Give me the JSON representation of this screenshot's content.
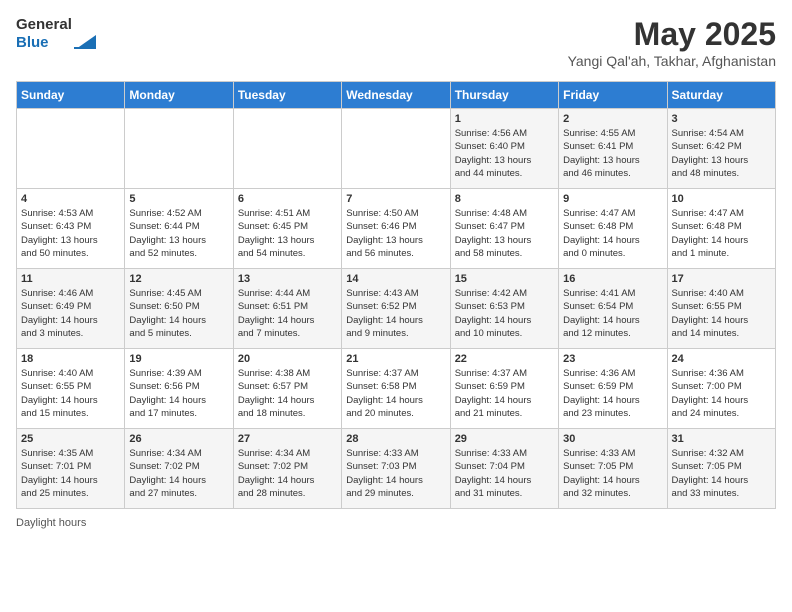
{
  "header": {
    "logo_general": "General",
    "logo_blue": "Blue",
    "month": "May 2025",
    "location": "Yangi Qal'ah, Takhar, Afghanistan"
  },
  "weekdays": [
    "Sunday",
    "Monday",
    "Tuesday",
    "Wednesday",
    "Thursday",
    "Friday",
    "Saturday"
  ],
  "weeks": [
    [
      {
        "day": "",
        "info": ""
      },
      {
        "day": "",
        "info": ""
      },
      {
        "day": "",
        "info": ""
      },
      {
        "day": "",
        "info": ""
      },
      {
        "day": "1",
        "info": "Sunrise: 4:56 AM\nSunset: 6:40 PM\nDaylight: 13 hours\nand 44 minutes."
      },
      {
        "day": "2",
        "info": "Sunrise: 4:55 AM\nSunset: 6:41 PM\nDaylight: 13 hours\nand 46 minutes."
      },
      {
        "day": "3",
        "info": "Sunrise: 4:54 AM\nSunset: 6:42 PM\nDaylight: 13 hours\nand 48 minutes."
      }
    ],
    [
      {
        "day": "4",
        "info": "Sunrise: 4:53 AM\nSunset: 6:43 PM\nDaylight: 13 hours\nand 50 minutes."
      },
      {
        "day": "5",
        "info": "Sunrise: 4:52 AM\nSunset: 6:44 PM\nDaylight: 13 hours\nand 52 minutes."
      },
      {
        "day": "6",
        "info": "Sunrise: 4:51 AM\nSunset: 6:45 PM\nDaylight: 13 hours\nand 54 minutes."
      },
      {
        "day": "7",
        "info": "Sunrise: 4:50 AM\nSunset: 6:46 PM\nDaylight: 13 hours\nand 56 minutes."
      },
      {
        "day": "8",
        "info": "Sunrise: 4:48 AM\nSunset: 6:47 PM\nDaylight: 13 hours\nand 58 minutes."
      },
      {
        "day": "9",
        "info": "Sunrise: 4:47 AM\nSunset: 6:48 PM\nDaylight: 14 hours\nand 0 minutes."
      },
      {
        "day": "10",
        "info": "Sunrise: 4:47 AM\nSunset: 6:48 PM\nDaylight: 14 hours\nand 1 minute."
      }
    ],
    [
      {
        "day": "11",
        "info": "Sunrise: 4:46 AM\nSunset: 6:49 PM\nDaylight: 14 hours\nand 3 minutes."
      },
      {
        "day": "12",
        "info": "Sunrise: 4:45 AM\nSunset: 6:50 PM\nDaylight: 14 hours\nand 5 minutes."
      },
      {
        "day": "13",
        "info": "Sunrise: 4:44 AM\nSunset: 6:51 PM\nDaylight: 14 hours\nand 7 minutes."
      },
      {
        "day": "14",
        "info": "Sunrise: 4:43 AM\nSunset: 6:52 PM\nDaylight: 14 hours\nand 9 minutes."
      },
      {
        "day": "15",
        "info": "Sunrise: 4:42 AM\nSunset: 6:53 PM\nDaylight: 14 hours\nand 10 minutes."
      },
      {
        "day": "16",
        "info": "Sunrise: 4:41 AM\nSunset: 6:54 PM\nDaylight: 14 hours\nand 12 minutes."
      },
      {
        "day": "17",
        "info": "Sunrise: 4:40 AM\nSunset: 6:55 PM\nDaylight: 14 hours\nand 14 minutes."
      }
    ],
    [
      {
        "day": "18",
        "info": "Sunrise: 4:40 AM\nSunset: 6:55 PM\nDaylight: 14 hours\nand 15 minutes."
      },
      {
        "day": "19",
        "info": "Sunrise: 4:39 AM\nSunset: 6:56 PM\nDaylight: 14 hours\nand 17 minutes."
      },
      {
        "day": "20",
        "info": "Sunrise: 4:38 AM\nSunset: 6:57 PM\nDaylight: 14 hours\nand 18 minutes."
      },
      {
        "day": "21",
        "info": "Sunrise: 4:37 AM\nSunset: 6:58 PM\nDaylight: 14 hours\nand 20 minutes."
      },
      {
        "day": "22",
        "info": "Sunrise: 4:37 AM\nSunset: 6:59 PM\nDaylight: 14 hours\nand 21 minutes."
      },
      {
        "day": "23",
        "info": "Sunrise: 4:36 AM\nSunset: 6:59 PM\nDaylight: 14 hours\nand 23 minutes."
      },
      {
        "day": "24",
        "info": "Sunrise: 4:36 AM\nSunset: 7:00 PM\nDaylight: 14 hours\nand 24 minutes."
      }
    ],
    [
      {
        "day": "25",
        "info": "Sunrise: 4:35 AM\nSunset: 7:01 PM\nDaylight: 14 hours\nand 25 minutes."
      },
      {
        "day": "26",
        "info": "Sunrise: 4:34 AM\nSunset: 7:02 PM\nDaylight: 14 hours\nand 27 minutes."
      },
      {
        "day": "27",
        "info": "Sunrise: 4:34 AM\nSunset: 7:02 PM\nDaylight: 14 hours\nand 28 minutes."
      },
      {
        "day": "28",
        "info": "Sunrise: 4:33 AM\nSunset: 7:03 PM\nDaylight: 14 hours\nand 29 minutes."
      },
      {
        "day": "29",
        "info": "Sunrise: 4:33 AM\nSunset: 7:04 PM\nDaylight: 14 hours\nand 31 minutes."
      },
      {
        "day": "30",
        "info": "Sunrise: 4:33 AM\nSunset: 7:05 PM\nDaylight: 14 hours\nand 32 minutes."
      },
      {
        "day": "31",
        "info": "Sunrise: 4:32 AM\nSunset: 7:05 PM\nDaylight: 14 hours\nand 33 minutes."
      }
    ]
  ],
  "footer": {
    "daylight_label": "Daylight hours"
  }
}
